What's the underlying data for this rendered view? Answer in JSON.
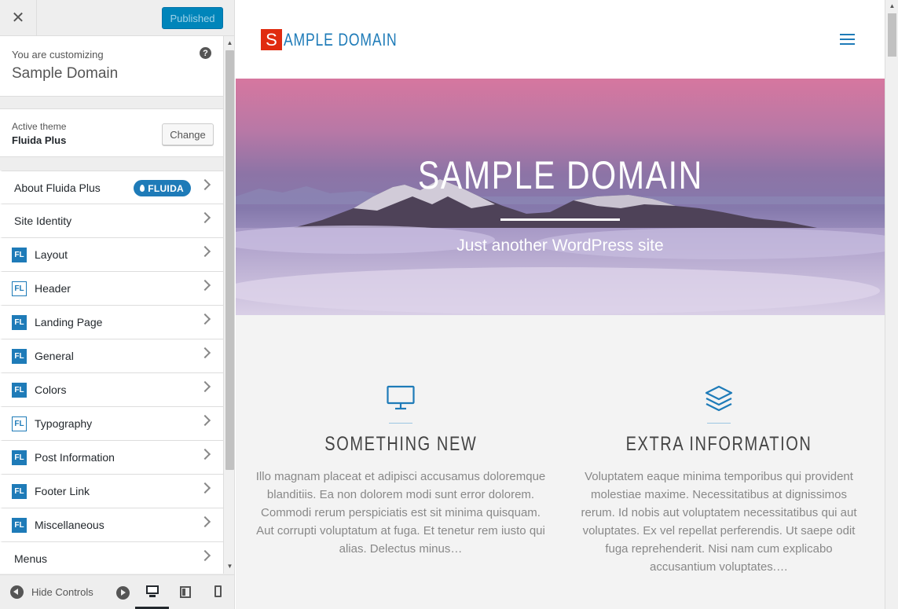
{
  "header": {
    "close_glyph": "✕",
    "publish_label": "Published"
  },
  "customizing": {
    "label": "You are customizing",
    "site_name": "Sample Domain",
    "help_glyph": "?"
  },
  "theme": {
    "label": "Active theme",
    "name": "Fluida Plus",
    "change_label": "Change"
  },
  "sections": [
    {
      "label": "About Fluida Plus",
      "badge": null,
      "pill": "FLUIDA"
    },
    {
      "label": "Site Identity",
      "badge": null
    },
    {
      "label": "Layout",
      "badge": "FL",
      "badge_style": "solid"
    },
    {
      "label": "Header",
      "badge": "FL",
      "badge_style": "outline"
    },
    {
      "label": "Landing Page",
      "badge": "FL",
      "badge_style": "solid"
    },
    {
      "label": "General",
      "badge": "FL",
      "badge_style": "solid"
    },
    {
      "label": "Colors",
      "badge": "FL",
      "badge_style": "solid"
    },
    {
      "label": "Typography",
      "badge": "FL",
      "badge_style": "outline"
    },
    {
      "label": "Post Information",
      "badge": "FL",
      "badge_style": "solid"
    },
    {
      "label": "Footer Link",
      "badge": "FL",
      "badge_style": "solid"
    },
    {
      "label": "Miscellaneous",
      "badge": "FL",
      "badge_style": "solid"
    },
    {
      "label": "Menus",
      "badge": null
    }
  ],
  "footer": {
    "hide_controls_label": "Hide Controls",
    "selected_device": "desktop"
  },
  "preview": {
    "logo_letter": "S",
    "logo_rest": "AMPLE DOMAIN",
    "hero_title": "SAMPLE DOMAIN",
    "hero_subtitle": "Just another WordPress site",
    "features": [
      {
        "icon": "monitor-icon",
        "title": "SOMETHING NEW",
        "text": "Illo magnam placeat et adipisci accusamus doloremque blanditiis. Ea non dolorem modi sunt error dolorem. Commodi rerum perspiciatis est sit minima quisquam. Aut corrupti voluptatum at fuga. Et tenetur rem iusto qui alias. Delectus minus…"
      },
      {
        "icon": "layers-icon",
        "title": "EXTRA INFORMATION",
        "text": "Voluptatem eaque minima temporibus qui provident molestiae maxime. Necessitatibus at dignissimos rerum. Id nobis aut voluptatem necessitatibus qui aut voluptates. Ex vel repellat perferendis. Ut saepe odit fuga reprehenderit. Nisi nam cum explicabo accusantium voluptates.…"
      }
    ]
  },
  "colors": {
    "accent": "#1e7bb8",
    "publish": "#0085ba",
    "logo_red": "#e02b0f"
  }
}
